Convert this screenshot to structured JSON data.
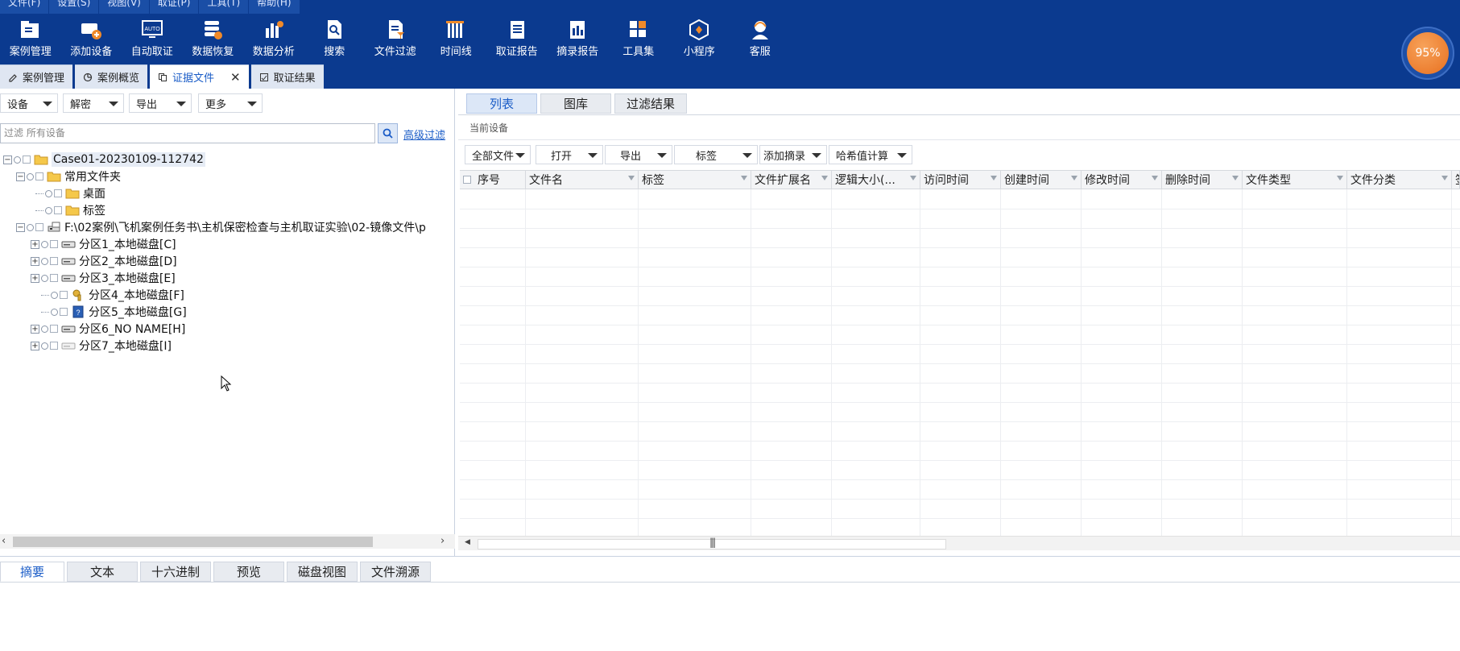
{
  "menubar": [
    "文件(F)",
    "设置(S)",
    "视图(V)",
    "取证(P)",
    "工具(T)",
    "帮助(H)"
  ],
  "toolbar": [
    {
      "label": "案例管理",
      "icon": "case-folder-icon"
    },
    {
      "label": "添加设备",
      "icon": "add-device-icon"
    },
    {
      "label": "自动取证",
      "icon": "auto-monitor-icon"
    },
    {
      "label": "数据恢复",
      "icon": "data-recovery-icon"
    },
    {
      "label": "数据分析",
      "icon": "analysis-chart-icon"
    },
    {
      "label": "搜索",
      "icon": "search-doc-icon"
    },
    {
      "label": "文件过滤",
      "icon": "filter-doc-icon"
    },
    {
      "label": "时间线",
      "icon": "timeline-icon"
    },
    {
      "label": "取证报告",
      "icon": "report-icon"
    },
    {
      "label": "摘录报告",
      "icon": "excerpt-report-icon"
    },
    {
      "label": "工具集",
      "icon": "toolset-icon"
    },
    {
      "label": "小程序",
      "icon": "miniprogram-icon"
    },
    {
      "label": "客服",
      "icon": "customer-service-icon"
    }
  ],
  "progress": {
    "label": "95%",
    "value": 95
  },
  "page_tabs": [
    {
      "label": "案例管理",
      "active": false
    },
    {
      "label": "案例概览",
      "active": false
    },
    {
      "label": "证据文件",
      "active": true
    },
    {
      "label": "取证结果",
      "active": false
    }
  ],
  "left": {
    "dropdowns": [
      "设备",
      "解密",
      "导出",
      "更多"
    ],
    "filter_placeholder": "过滤 所有设备",
    "advanced_filter": "高级过滤",
    "tree": [
      {
        "label": "Case01-20230109-112742",
        "icon": "folder-open-icon"
      },
      {
        "label": "常用文件夹",
        "icon": "folder-icon"
      },
      {
        "label": "桌面",
        "icon": "folder-icon"
      },
      {
        "label": "标签",
        "icon": "folder-icon"
      },
      {
        "label": "F:\\02案例\\飞机案例任务书\\主机保密检查与主机取证实验\\02-镜像文件\\p",
        "icon": "disk-image-icon"
      },
      {
        "label": "分区1_本地磁盘[C]",
        "icon": "drive-icon"
      },
      {
        "label": "分区2_本地磁盘[D]",
        "icon": "drive-icon"
      },
      {
        "label": "分区3_本地磁盘[E]",
        "icon": "drive-icon"
      },
      {
        "label": "分区4_本地磁盘[F]",
        "icon": "locked-drive-icon"
      },
      {
        "label": "分区5_本地磁盘[G]",
        "icon": "encrypted-drive-icon"
      },
      {
        "label": "分区6_NO NAME[H]",
        "icon": "drive-icon"
      },
      {
        "label": "分区7_本地磁盘[I]",
        "icon": "empty-drive-icon"
      }
    ]
  },
  "right": {
    "view_tabs": [
      {
        "label": "列表",
        "active": true
      },
      {
        "label": "图库",
        "active": false
      },
      {
        "label": "过滤结果",
        "active": false
      }
    ],
    "current_device_label": "当前设备",
    "toolbar_dropdowns": [
      "全部文件",
      "打开",
      "导出",
      "标签",
      "添加摘录",
      "哈希值计算"
    ],
    "columns": [
      "序号",
      "文件名",
      "标签",
      "文件扩展名",
      "逻辑大小(...",
      "访问时间",
      "创建时间",
      "修改时间",
      "删除时间",
      "文件类型",
      "文件分类",
      "签"
    ]
  },
  "bottom_tabs": [
    {
      "label": "摘要",
      "active": true
    },
    {
      "label": "文本",
      "active": false
    },
    {
      "label": "十六进制",
      "active": false
    },
    {
      "label": "预览",
      "active": false
    },
    {
      "label": "磁盘视图",
      "active": false
    },
    {
      "label": "文件溯源",
      "active": false
    }
  ],
  "colors": {
    "chrome": "#0b3a8f",
    "accent": "#1a5cc7",
    "progress": "#e8701f"
  }
}
